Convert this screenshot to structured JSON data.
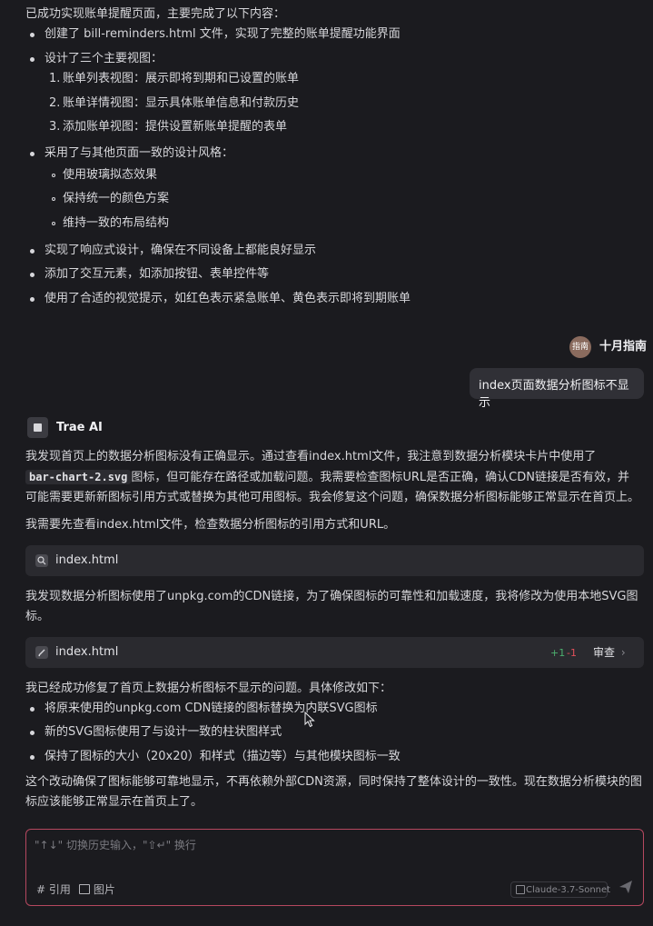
{
  "summary": {
    "intro": "已成功实现账单提醒页面，主要完成了以下内容：",
    "b1": "创建了 bill-reminders.html 文件，实现了完整的账单提醒功能界面",
    "b2": "设计了三个主要视图：",
    "views": [
      "账单列表视图：展示即将到期和已设置的账单",
      "账单详情视图：显示具体账单信息和付款历史",
      "添加账单视图：提供设置新账单提醒的表单"
    ],
    "view_nums": [
      "1.",
      "2.",
      "3."
    ],
    "b3": "采用了与其他页面一致的设计风格：",
    "styles": [
      "使用玻璃拟态效果",
      "保持统一的颜色方案",
      "维持一致的布局结构"
    ],
    "b4": "实现了响应式设计，确保在不同设备上都能良好显示",
    "b5": "添加了交互元素，如添加按钮、表单控件等",
    "b6": "使用了合适的视觉提示，如红色表示紧急账单、黄色表示即将到期账单"
  },
  "user": {
    "avatar_text": "指南",
    "name": "十月指南",
    "message": "index页面数据分析图标不显示"
  },
  "ai": {
    "name": "Trae AI",
    "p1_a": "我发现首页上的数据分析图标没有正确显示。通过查看index.html文件，我注意到数据分析模块卡片中使用了",
    "p1_code": "bar-chart-2.svg",
    "p1_b": "图标，但可能存在路径或加载问题。我需要检查图标URL是否正确，确认CDN链接是否有效，并",
    "p1_c": "可能需要更新新图标引用方式或替换为其他可用图标。我会修复这个问题，确保数据分析图标能够正常显示在首页上。",
    "p2": "我需要先查看index.html文件，检查数据分析图标的引用方式和URL。",
    "file1": "index.html",
    "p3_a": "我发现数据分析图标使用了unpkg.com的CDN链接，为了确保图标的可靠性和加载速度，我将修改为使用本地SVG图",
    "p3_b": "标。",
    "file2": "index.html",
    "diff_add": "+1",
    "diff_del": "-1",
    "review": "审查",
    "p4": "我已经成功修复了首页上数据分析图标不显示的问题。具体修改如下：",
    "c1": "将原来使用的unpkg.com CDN链接的图标替换为内联SVG图标",
    "c2": "新的SVG图标使用了与设计一致的柱状图样式",
    "c3": "保持了图标的大小（20x20）和样式（描边等）与其他模块图标一致",
    "p5_a": "这个改动确保了图标能够可靠地显示，不再依赖外部CDN资源，同时保持了整体设计的一致性。现在数据分析模块的图",
    "p5_b": "标应该能够正常显示在首页上了。"
  },
  "input": {
    "placeholder": "\"↑↓\" 切换历史输入，\"⇧↵\" 换行",
    "cite": "引用",
    "image": "图片",
    "model": "Claude-3.7-Sonnet"
  },
  "colors": {
    "accent_border": "#b5485f",
    "diff_add": "#4caf6f",
    "diff_del": "#e0505a"
  }
}
